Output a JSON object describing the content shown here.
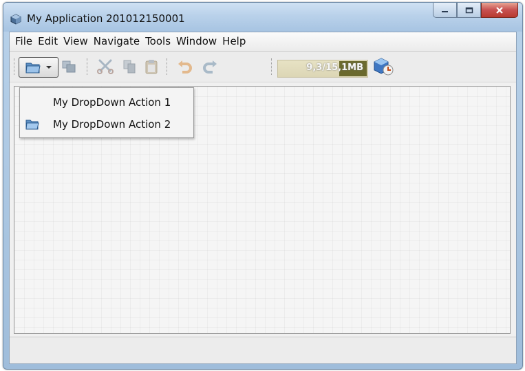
{
  "window": {
    "title": "My Application 201012150001",
    "controls": [
      "minimize",
      "maximize",
      "close"
    ]
  },
  "menubar": {
    "items": [
      "File",
      "Edit",
      "View",
      "Navigate",
      "Tools",
      "Window",
      "Help"
    ]
  },
  "toolbar": {
    "buttons": [
      {
        "icon": "open-project-icon",
        "state": "active",
        "has_dropdown": true
      },
      {
        "icon": "copy-windows-icon",
        "state": "disabled"
      },
      {
        "icon": "cut-icon",
        "state": "disabled"
      },
      {
        "icon": "copy-icon",
        "state": "disabled"
      },
      {
        "icon": "paste-icon",
        "state": "disabled"
      },
      {
        "icon": "undo-icon",
        "state": "disabled"
      },
      {
        "icon": "redo-icon",
        "state": "disabled"
      },
      {
        "icon": "gc-memory-icon",
        "state": "enabled"
      }
    ],
    "memory": {
      "label": "9,3/15,1MB",
      "used_fraction": 0.62
    }
  },
  "dropdown": {
    "items": [
      {
        "label": "My DropDown Action 1",
        "icon": null
      },
      {
        "label": "My DropDown Action 2",
        "icon": "folder-icon"
      }
    ]
  },
  "colors": {
    "titlebar": "#b9d1ea",
    "close_button": "#c75050",
    "memory_fill": "#6b6a2e"
  }
}
